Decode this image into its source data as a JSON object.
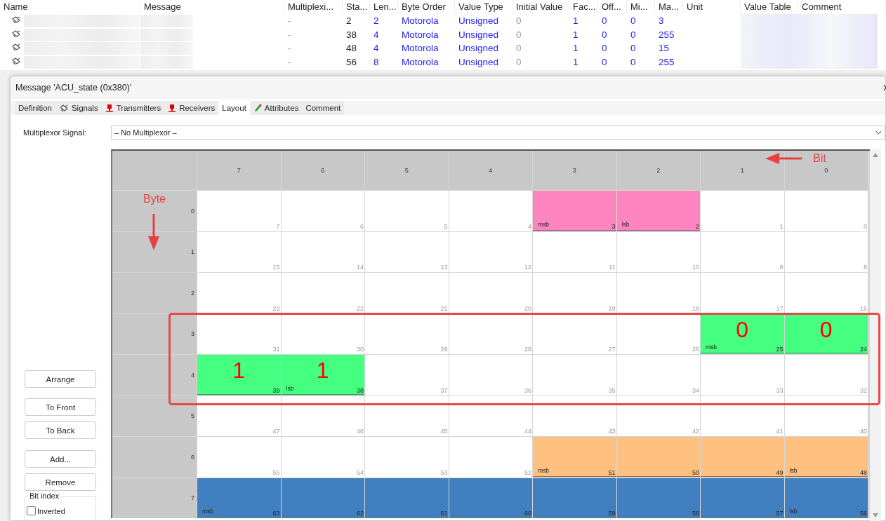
{
  "signal_table": {
    "columns": [
      "Name",
      "Message",
      "Multiplexi...",
      "Sta...",
      "Len...",
      "Byte Order",
      "Value Type",
      "Initial Value",
      "Fac...",
      "Off...",
      "Mi...",
      "Ma...",
      "Unit",
      "Value Table",
      "Comment"
    ],
    "rows": [
      {
        "values": [
          "-",
          "2",
          "2",
          "Motorola",
          "Unsigned",
          "0",
          "1",
          "0",
          "0",
          "3"
        ]
      },
      {
        "values": [
          "-",
          "38",
          "4",
          "Motorola",
          "Unsigned",
          "0",
          "1",
          "0",
          "0",
          "255"
        ]
      },
      {
        "values": [
          "-",
          "48",
          "4",
          "Motorola",
          "Unsigned",
          "0",
          "1",
          "0",
          "0",
          "15"
        ]
      },
      {
        "values": [
          "-",
          "56",
          "8",
          "Motorola",
          "Unsigned",
          "0",
          "1",
          "0",
          "0",
          "255"
        ]
      }
    ]
  },
  "dialog": {
    "title": "Message 'ACU_state (0x380)'",
    "tabs": [
      {
        "label": "Definition",
        "selected": false
      },
      {
        "label": "Signals",
        "kind": "signal",
        "selected": false
      },
      {
        "label": "Transmitters",
        "kind": "node",
        "selected": false
      },
      {
        "label": "Receivers",
        "kind": "node",
        "selected": false
      },
      {
        "label": "Layout",
        "selected": true
      },
      {
        "label": "Attributes",
        "kind": "pen",
        "selected": false
      },
      {
        "label": "Comment",
        "selected": false
      }
    ],
    "multiplexor": {
      "label": "Multiplexor Signal:",
      "value": "– No Multiplexor –"
    },
    "buttons": [
      "Arrange",
      "To Front",
      "To Back",
      "Add...",
      "Remove"
    ],
    "bit_index": {
      "title": "Bit index",
      "inverted_label": "Inverted",
      "inverted": false
    },
    "layout_grid": {
      "bit_headers": [
        "7",
        "6",
        "5",
        "4",
        "3",
        "2",
        "1",
        "0"
      ],
      "rows": [
        {
          "byte": "0",
          "cells": [
            {
              "bit": "7"
            },
            {
              "bit": "6"
            },
            {
              "bit": "5"
            },
            {
              "bit": "4"
            },
            {
              "bit": "3",
              "color": "#ff85c0",
              "tag": "msb"
            },
            {
              "bit": "2",
              "color": "#ff85c0",
              "tag": "lsb"
            },
            {
              "bit": "1"
            },
            {
              "bit": "0"
            }
          ]
        },
        {
          "byte": "1",
          "cells": [
            {
              "bit": "15"
            },
            {
              "bit": "14"
            },
            {
              "bit": "13"
            },
            {
              "bit": "12"
            },
            {
              "bit": "11"
            },
            {
              "bit": "10"
            },
            {
              "bit": "9"
            },
            {
              "bit": "8"
            }
          ]
        },
        {
          "byte": "2",
          "cells": [
            {
              "bit": "23"
            },
            {
              "bit": "22"
            },
            {
              "bit": "21"
            },
            {
              "bit": "20"
            },
            {
              "bit": "19"
            },
            {
              "bit": "18"
            },
            {
              "bit": "17"
            },
            {
              "bit": "16"
            }
          ]
        },
        {
          "byte": "3",
          "cells": [
            {
              "bit": "31"
            },
            {
              "bit": "30"
            },
            {
              "bit": "29"
            },
            {
              "bit": "28"
            },
            {
              "bit": "27"
            },
            {
              "bit": "26"
            },
            {
              "bit": "25",
              "color": "#44ff80",
              "tag": "msb",
              "value": "0"
            },
            {
              "bit": "24",
              "color": "#44ff80",
              "value": "0"
            }
          ]
        },
        {
          "byte": "4",
          "cells": [
            {
              "bit": "39",
              "color": "#44ff80",
              "value": "1"
            },
            {
              "bit": "38",
              "color": "#44ff80",
              "tag": "lsb",
              "value": "1"
            },
            {
              "bit": "37"
            },
            {
              "bit": "36"
            },
            {
              "bit": "35"
            },
            {
              "bit": "34"
            },
            {
              "bit": "33"
            },
            {
              "bit": "32"
            }
          ]
        },
        {
          "byte": "5",
          "cells": [
            {
              "bit": "47"
            },
            {
              "bit": "46"
            },
            {
              "bit": "45"
            },
            {
              "bit": "44"
            },
            {
              "bit": "43"
            },
            {
              "bit": "42"
            },
            {
              "bit": "41"
            },
            {
              "bit": "40"
            }
          ]
        },
        {
          "byte": "6",
          "cells": [
            {
              "bit": "55"
            },
            {
              "bit": "54"
            },
            {
              "bit": "53"
            },
            {
              "bit": "52"
            },
            {
              "bit": "51",
              "color": "#ffc080",
              "tag": "msb"
            },
            {
              "bit": "50",
              "color": "#ffc080"
            },
            {
              "bit": "49",
              "color": "#ffc080"
            },
            {
              "bit": "48",
              "color": "#ffc080",
              "tag": "lsb"
            }
          ]
        },
        {
          "byte": "7",
          "cells": [
            {
              "bit": "63",
              "color": "#4080c0",
              "tag": "msb"
            },
            {
              "bit": "62",
              "color": "#4080c0"
            },
            {
              "bit": "61",
              "color": "#4080c0"
            },
            {
              "bit": "60",
              "color": "#4080c0"
            },
            {
              "bit": "59",
              "color": "#4080c0"
            },
            {
              "bit": "58",
              "color": "#4080c0"
            },
            {
              "bit": "57",
              "color": "#4080c0"
            },
            {
              "bit": "56",
              "color": "#4080c0",
              "tag": "lsb"
            }
          ]
        }
      ]
    },
    "annotations": {
      "byte_label": "Byte",
      "bit_label": "Bit"
    }
  }
}
